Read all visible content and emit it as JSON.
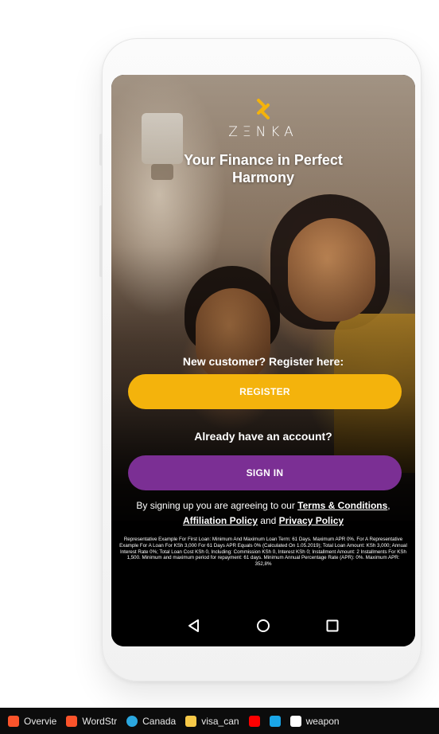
{
  "app": {
    "brand": "ZΞNKA",
    "tagline": "Your Finance in Perfect Harmony"
  },
  "register_section": {
    "prompt": "New customer? Register here:",
    "button_label": "REGISTER"
  },
  "signin_section": {
    "prompt": "Already have an account?",
    "button_label": "SIGN IN"
  },
  "agreement": {
    "prefix": "By signing up you are agreeing to our",
    "terms_link": "Terms & Conditions",
    "comma": ",",
    "affiliation_link": "Affiliation Policy",
    "and": "and",
    "privacy_link": "Privacy Policy"
  },
  "disclaimer": "Representative Example For First Loan: Minimum And Maximum Loan Term: 61 Days. Maximum APR 0%. For A Representative Example For A Loan For KSh 3,000 For 61 Days APR Equals 0% (Calculated On 1.05.2019); Total Loan Amount: KSh 3,000; Annual Interest Rate 0%; Total Loan Cost KSh 0, Including: Commission KSh 0, Interest KSh 0; Installment Amount: 2 Installments For KSh 1,500. Minimum and maximum period for repayment: 61 days. Minimum Annual Percentage Rate (APR): 0%. Maximum APR: 352,8%",
  "navbar": {
    "back_icon": "back-triangle-icon",
    "home_icon": "home-circle-icon",
    "recents_icon": "recents-square-icon"
  },
  "taskbar": {
    "tabs": [
      {
        "label": "Overvie",
        "icon": "brave-icon",
        "color": "#fb542b"
      },
      {
        "label": "WordStr",
        "icon": "brave-icon",
        "color": "#fb542b"
      },
      {
        "label": "Canada",
        "icon": "edge-icon",
        "color": "#2ba8e0"
      },
      {
        "label": "visa_can",
        "icon": "folder-icon",
        "color": "#f7c948"
      },
      {
        "label": "",
        "icon": "youtube-icon",
        "color": "#ff0000"
      },
      {
        "label": "",
        "icon": "prime-video-icon",
        "color": "#1aa6e8"
      },
      {
        "label": "weapon",
        "icon": "w-icon",
        "color": "#ffffff"
      }
    ]
  },
  "colors": {
    "register": "#f4b30c",
    "signin": "#7b2f94",
    "logo": "#f4b30c"
  }
}
